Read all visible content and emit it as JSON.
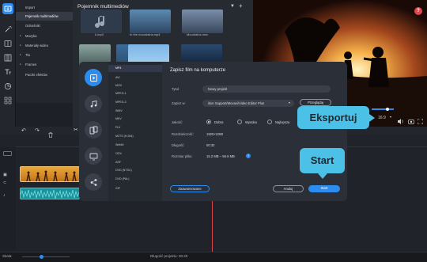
{
  "sidebar": {
    "items": [
      {
        "label": "Import",
        "selected": false,
        "expandable": false
      },
      {
        "label": "Pojemnik multimediów",
        "selected": true,
        "expandable": false
      },
      {
        "label": "Odnośniki",
        "selected": false,
        "expandable": false
      },
      {
        "label": "Muzyka",
        "selected": false,
        "expandable": true
      },
      {
        "label": "Materiały wideo",
        "selected": false,
        "expandable": true
      },
      {
        "label": "Tła",
        "selected": false,
        "expandable": true
      },
      {
        "label": "Frames",
        "selected": false,
        "expandable": true
      },
      {
        "label": "Paczki efektów",
        "selected": false,
        "expandable": false
      }
    ]
  },
  "media": {
    "title": "Pojemnik multimediów",
    "files": [
      {
        "label": "k.mp3",
        "kind": "audio"
      },
      {
        "label": "to the mountains.mp4",
        "kind": "video"
      },
      {
        "label": "Mountains.mov",
        "kind": "video"
      }
    ]
  },
  "player": {
    "aspect": "16:9",
    "export_button": "Eksportuj"
  },
  "dialog": {
    "title": "Zapisz film na komputerze",
    "formats": [
      "MP4",
      "AVI",
      "MOV",
      "MPEG-1",
      "MPEG-2",
      "WMV",
      "MKV",
      "FLV",
      "M2TS (H.264)",
      "WebM",
      "OGV",
      "ASF",
      "DVD (NTSC)",
      "DVD (PAL)",
      "GIF"
    ],
    "selected_format": "MP4",
    "title_label": "Tytuł",
    "title_value": "Nowy projekt",
    "save_label": "Zapisz w:",
    "save_value": "ition Support/Movavi/Video Editor Plus",
    "browse_label": "Przeglądaj",
    "quality_label": "Jakość:",
    "quality_options": [
      "Dobra",
      "Wysoka",
      "Najlepsza"
    ],
    "quality_selected": "Dobra",
    "resolution_label": "Rozdzielczość:",
    "resolution_value": "1920×1080",
    "duration_label": "Długość:",
    "duration_value": "00:32",
    "size_label": "Rozmiar pliku:",
    "size_value": "15.2 MB – 56.9 MB",
    "advanced_label": "Zaawansowane",
    "cancel_label": "Anuluj",
    "start_label": "Start"
  },
  "callouts": {
    "export": "Eksportuj",
    "start": "Start"
  },
  "status": {
    "scale_label": "Skala:",
    "duration_label": "Długość projektu:",
    "duration_value": "00:40"
  },
  "colors": {
    "accent": "#2d8cf0",
    "callout": "#4cc1e8",
    "help_badge": "#e0474c",
    "video_clip": "#e39a2a",
    "audio_clip": "#1aa9a9"
  }
}
